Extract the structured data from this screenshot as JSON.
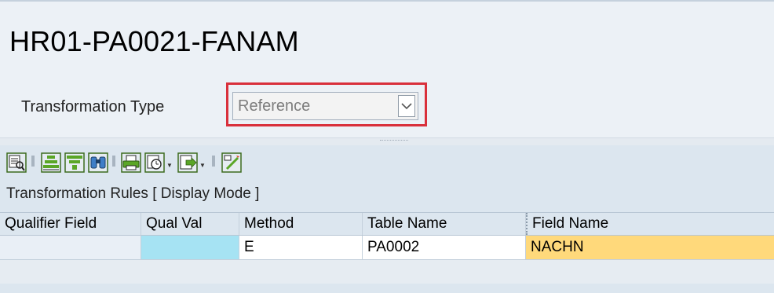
{
  "header": {
    "title": "HR01-PA0021-FANAM",
    "transformation_type_label": "Transformation Type",
    "transformation_type_value": "Reference"
  },
  "toolbar": {
    "icons": [
      "details-icon",
      "sort-ascending-icon",
      "filter-icon",
      "find-icon",
      "print-icon",
      "layout-icon",
      "export-icon",
      "edit-icon"
    ]
  },
  "rules": {
    "title": "Transformation Rules [ Display Mode ]",
    "columns": [
      "Qualifier Field",
      "Qual Val",
      "Method",
      "Table Name",
      "Field Name"
    ],
    "rows": [
      {
        "qualifier_field": "",
        "qual_val": "",
        "method": "E",
        "table_name": "PA0002",
        "field_name": "NACHN"
      }
    ]
  },
  "colors": {
    "highlight_border": "#d9303b",
    "qual_val_cell": "#a6e3f3",
    "field_name_cell": "#ffd97b",
    "panel_bg": "#dce6ef"
  }
}
